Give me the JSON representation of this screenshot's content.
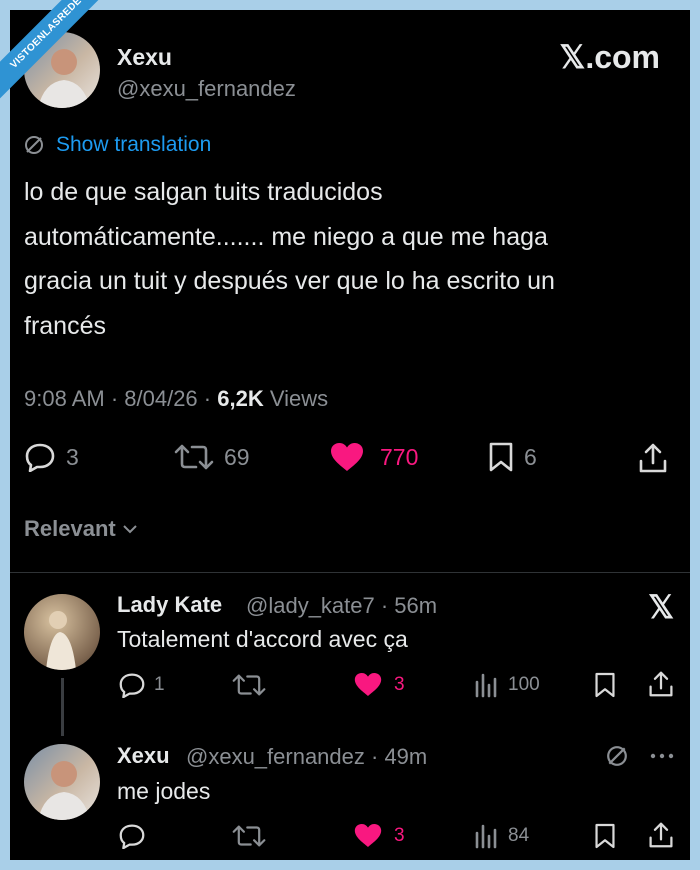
{
  "watermark": "VISTOENLASREDES",
  "tweet": {
    "author_name": "Xexu",
    "author_handle": "@xexu_fernandez",
    "source_brand": "𝕏.com",
    "show_translation": "Show translation",
    "lines": [
      "lo de que salgan tuits traducidos",
      "automáticamente....... me niego a que me haga",
      "gracia un tuit y después ver que lo ha escrito un",
      "francés"
    ],
    "time": "9:08 AM · 8/04/26 · ",
    "views_count": "6,2K",
    "views_label": " Views",
    "replies": "3",
    "reposts": "69",
    "likes": "770",
    "bookmarks": "6"
  },
  "sort": {
    "label": "Relevant"
  },
  "replies": [
    {
      "name": "Lady Kate",
      "handle": "@lady_kate7 · 56m",
      "text": "Totalement d'accord avec ça",
      "replies": "1",
      "likes": "3",
      "views": "100"
    },
    {
      "name": "Xexu",
      "handle": "@xexu_fernandez · 49m",
      "text": "me jodes",
      "likes": "3",
      "views": "84"
    }
  ],
  "colors": {
    "accent": "#1d9bf0",
    "like": "#f91880",
    "muted": "#8b8f94",
    "text": "#e7e9ea"
  }
}
